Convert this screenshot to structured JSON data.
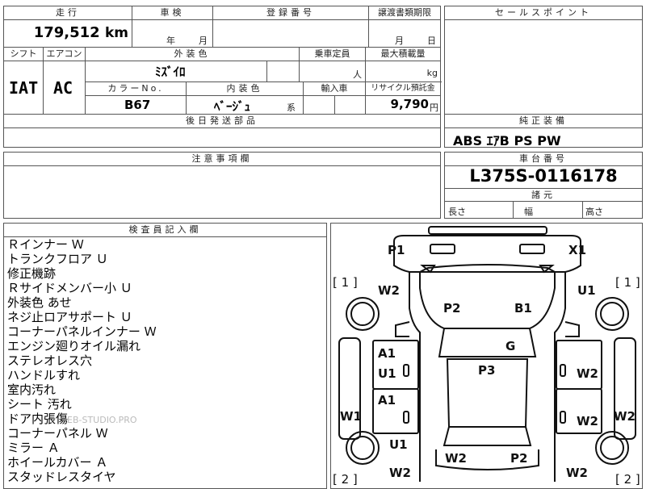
{
  "top_row": {
    "mileage_label": "走行",
    "mileage_value": "179,512",
    "mileage_unit": "km",
    "inspection_label": "車検",
    "inspection_year": "年",
    "inspection_month": "月",
    "registration_label": "登録番号",
    "transfer_label": "譲渡書類期限",
    "transfer_month": "月",
    "transfer_day": "日"
  },
  "sales_point": {
    "label": "セールスポイント"
  },
  "row2": {
    "shift_label": "シフト",
    "shift_value": "IAT",
    "ac_label": "エアコン",
    "ac_value": "AC",
    "exterior_color_label": "外装色",
    "exterior_color_value": "ﾐｽﾞｲﾛ",
    "capacity_label": "乗車定員",
    "capacity_unit": "人",
    "max_load_label": "最大積載量",
    "max_load_unit": "kg",
    "color_no_label": "カラーNo.",
    "color_no_value": "B67",
    "interior_label": "内装色",
    "interior_value": "ﾍﾞｰｼﾞｭ",
    "interior_suffix": "系",
    "import_label": "輸入車",
    "recycle_label": "リサイクル預託金",
    "recycle_value": "9,790",
    "recycle_unit": "円"
  },
  "later_parts": {
    "label": "後日発送部品"
  },
  "equipment": {
    "label": "純正装備",
    "value": "ABS ｴｱB PS PW"
  },
  "notes": {
    "label": "注意事項欄"
  },
  "chassis": {
    "label": "車台番号",
    "value": "L375S-0116178",
    "dims_label": "諸元",
    "length_label": "長さ",
    "width_label": "幅",
    "height_label": "高さ"
  },
  "inspector": {
    "label": "検査員記入欄",
    "items": [
      "Ｒインナー Ｗ",
      "トランクフロア Ｕ",
      "修正機跡",
      "Ｒサイドメンバー小 Ｕ",
      "外装色 あせ",
      "ネジ止ロアサポート Ｕ",
      "コーナーパネルインナー Ｗ",
      "エンジン廻りオイル漏れ",
      "ステレオレス穴",
      "ハンドルすれ",
      "室内汚れ",
      "シート 汚れ",
      "ドア内張傷",
      "コーナーパネル Ｗ",
      "ミラー Ａ",
      "ホイールカバー Ａ",
      "スタッドレスタイヤ"
    ],
    "watermark": "EB-STUDIO.PRO"
  },
  "diagram": {
    "marks": {
      "p1": "P1",
      "x1": "X1",
      "b1_top_left": "[ 1 ]",
      "b1_top_right": "[ 1 ]",
      "w2_left": "W2",
      "u1_right": "U1",
      "p2_hood": "P2",
      "b1": "B1",
      "g": "G",
      "a1_front": "A1",
      "u1_front": "U1",
      "p3": "P3",
      "w2_front_right": "W2",
      "a1_rear": "A1",
      "w2_rear_right": "W2",
      "w1_left": "W1",
      "w2_far_right": "W2",
      "u1_rear": "U1",
      "w2_bottom_mid": "W2",
      "p2_bottom": "P2",
      "w2_bottom_left": "W2",
      "w2_bottom_right": "W2",
      "b2_bottom_left": "[ 2 ]",
      "b2_bottom_right": "[ 2 ]"
    }
  }
}
